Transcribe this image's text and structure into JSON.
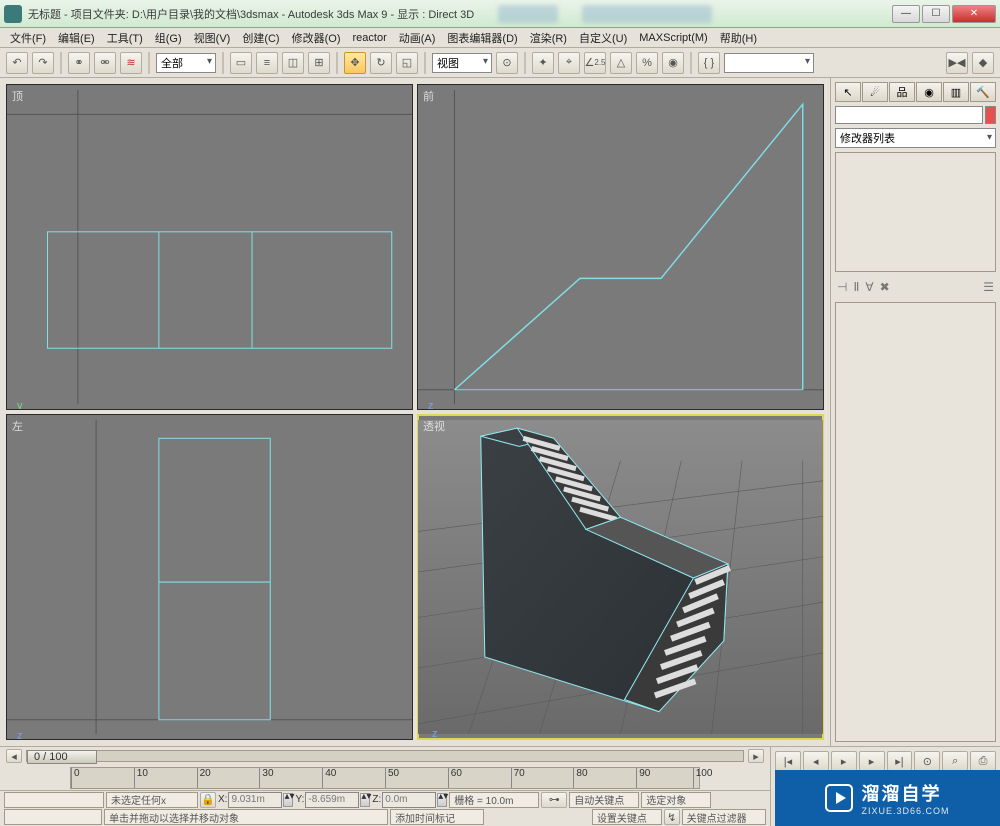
{
  "title": "无标题    - 项目文件夹:  D:\\用户目录\\我的文档\\3dsmax      - Autodesk 3ds Max 9      - 显示 : Direct 3D",
  "menu": [
    "文件(F)",
    "编辑(E)",
    "工具(T)",
    "组(G)",
    "视图(V)",
    "创建(C)",
    "修改器(O)",
    "reactor",
    "动画(A)",
    "图表编辑器(D)",
    "渲染(R)",
    "自定义(U)",
    "MAXScript(M)",
    "帮助(H)"
  ],
  "toolbar": {
    "selset": "全部",
    "viewsel": "视图",
    "degval": "2.5"
  },
  "viewports": {
    "top": "顶",
    "front": "前",
    "left": "左",
    "persp": "透视"
  },
  "panel": {
    "name_value": "",
    "modlist": "修改器列表"
  },
  "timeline": {
    "framecount": "0 / 100",
    "ticks": [
      "0",
      "10",
      "20",
      "30",
      "40",
      "50",
      "60",
      "70",
      "80",
      "90",
      "100"
    ]
  },
  "status": {
    "sel_none": "未选定任何x",
    "x_label": "X:",
    "x_val": "9.031m",
    "y_label": "Y:",
    "y_val": "-8.659m",
    "z_label": "Z:",
    "z_val": "0.0m",
    "grid": "栅格 = 10.0m",
    "autokey": "自动关键点",
    "selobj": "选定对象",
    "hint": "单击并拖动以选择并移动对象",
    "addmark": "添加时间标记",
    "setkey": "设置关键点",
    "keyfilter": "关键点过滤器"
  },
  "watermark": {
    "name": "溜溜自学",
    "url": "ZIXUE.3D66.COM"
  }
}
